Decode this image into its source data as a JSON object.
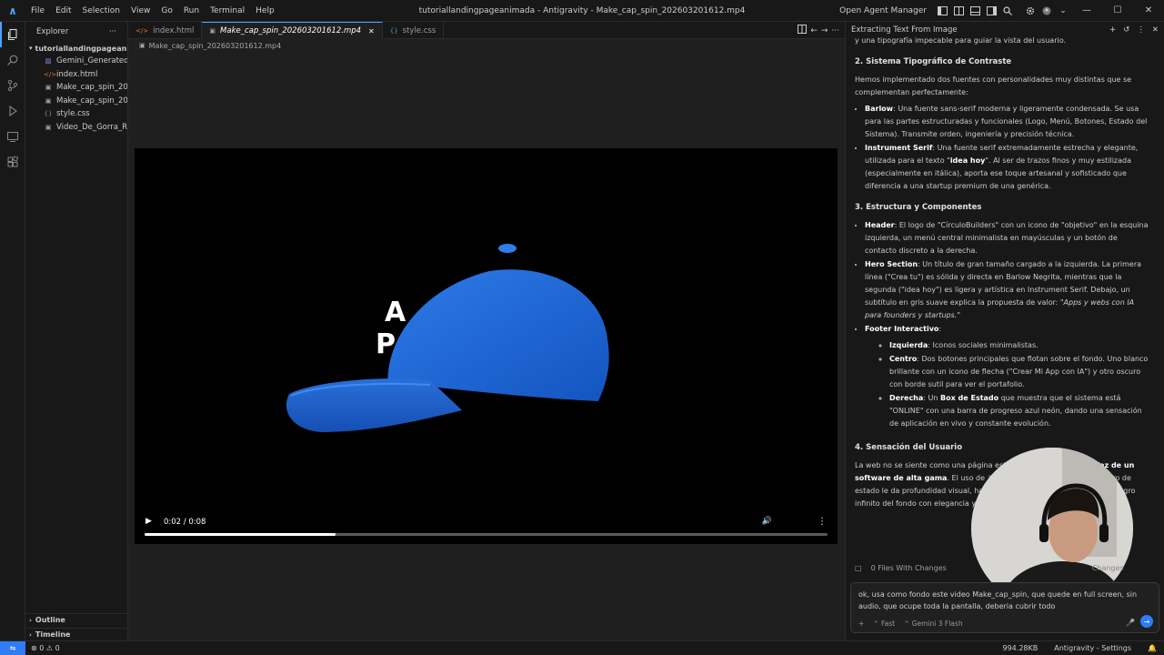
{
  "titlebar": {
    "menu": [
      "File",
      "Edit",
      "Selection",
      "View",
      "Go",
      "Run",
      "Terminal",
      "Help"
    ],
    "window_title": "tutoriallandingpageanimada - Antigravity - Make_cap_spin_202603201612.mp4",
    "open_agent_manager": "Open Agent Manager",
    "minimize": "—",
    "maximize": "☐",
    "close": "✕"
  },
  "sidebar": {
    "title": "Explorer",
    "more": "···",
    "folder": "tutoriallandingpageanim...",
    "files": [
      {
        "name": "Gemini_Generated...",
        "icon": "▨",
        "color": "#b180d7"
      },
      {
        "name": "index.html",
        "icon": "</>",
        "color": "#e37933"
      },
      {
        "name": "Make_cap_spin_20...",
        "icon": "▣",
        "color": "#a0a0a0"
      },
      {
        "name": "Make_cap_spin_20...",
        "icon": "▣",
        "color": "#a0a0a0"
      },
      {
        "name": "style.css",
        "icon": "{}",
        "color": "#519aba"
      },
      {
        "name": "Video_De_Gorra_R...",
        "icon": "▣",
        "color": "#a0a0a0"
      }
    ],
    "outline": "Outline",
    "timeline": "Timeline"
  },
  "editor": {
    "tabs": [
      {
        "label": "index.html",
        "icon": "</>",
        "color": "#e37933",
        "active": false
      },
      {
        "label": "Make_cap_spin_202603201612.mp4",
        "icon": "▣",
        "color": "#a0a0a0",
        "active": true
      },
      {
        "label": "style.css",
        "icon": "{}",
        "color": "#519aba",
        "active": false
      }
    ],
    "breadcrumb": "Make_cap_spin_202603201612.mp4",
    "video": {
      "time": "0:02 / 0:08",
      "progress": 0.28,
      "cap_text_line1": "A",
      "cap_text_line2": "P"
    }
  },
  "panel": {
    "title": "Extracting Text From Image",
    "intro_tail": "y una tipografía impecable para guiar la vista del usuario.",
    "s2_title": "2. Sistema Tipográfico de Contraste",
    "s2_intro": "Hemos implementado dos fuentes con personalidades muy distintas que se complementan perfectamente:",
    "s2_barlow_b": "Barlow",
    "s2_barlow": ": Una fuente sans-serif moderna y ligeramente condensada. Se usa para las partes estructuradas y funcionales (Logo, Menú, Botones, Estado del Sistema). Transmite orden, ingeniería y precisión técnica.",
    "s2_instr_b": "Instrument Serif",
    "s2_instr_1": ": Una fuente serif extremadamente estrecha y elegante, utilizada para el texto \"",
    "s2_instr_idea": "idea hoy",
    "s2_instr_2": "\". Al ser de trazos finos y muy estilizada (especialmente en itálica), aporta ese toque artesanal y sofisticado que diferencia a una startup premium de una genérica.",
    "s3_title": "3. Estructura y Componentes",
    "s3_header_b": "Header",
    "s3_header": ": El logo de \"CírculoBuilders\" con un icono de \"objetivo\" en la esquina izquierda, un menú central minimalista en mayúsculas y un botón de contacto discreto a la derecha.",
    "s3_hero_b": "Hero Section",
    "s3_hero_1": ": Un título de gran tamaño cargado a la izquierda. La primera línea (\"Crea tu\") es sólida y directa en Barlow Negrita, mientras que la segunda (\"idea hoy\") es ligera y artística en Instrument Serif. Debajo, un subtítulo en gris suave explica la propuesta de valor: ",
    "s3_hero_quote": "\"Apps y webs con IA para founders y startups.\"",
    "s3_footer_b": "Footer Interactivo",
    "s3_footer": ":",
    "s3_izq_b": "Izquierda",
    "s3_izq": ": Iconos sociales minimalistas.",
    "s3_centro_b": "Centro",
    "s3_centro": ": Dos botones principales que flotan sobre el fondo. Uno blanco brillante con un icono de flecha (\"Crear Mi App con IA\") y otro oscuro con borde sutil para ver el portafolio.",
    "s3_der_b": "Derecha",
    "s3_der_1": ": Un ",
    "s3_der_box": "Box de Estado",
    "s3_der_2": " que muestra que el sistema está \"ONLINE\" con una barra de progreso azul neón, dando una sensación de aplicación en vivo y constante evolución.",
    "s4_title": "4. Sensación del Usuario",
    "s4_1": "La web no se siente como una página estática, sino como la ",
    "s4_b": "interfaz de un software de alta gama",
    "s4_2": ". El uso de ",
    "s4_code": "backdrop",
    "s4_3": " en los botones y el cuadro de estado le da profundidad visual, haciendo que parezcan flotar sobre el negro infinito del fondo con elegancia y profesionalismo.",
    "files_changes": "0 Files With Changes",
    "changes": "Changes",
    "input_text": "ok, usa como fondo este video Make_cap_spin, que quede en full screen, sin audio, que ocupe toda la pantalla, deberia cubrir todo",
    "mode": "Fast",
    "model": "Gemini 3 Flash"
  },
  "statusbar": {
    "errors": "0",
    "warnings": "0",
    "size": "994.28KB",
    "settings": "Antigravity - Settings"
  }
}
